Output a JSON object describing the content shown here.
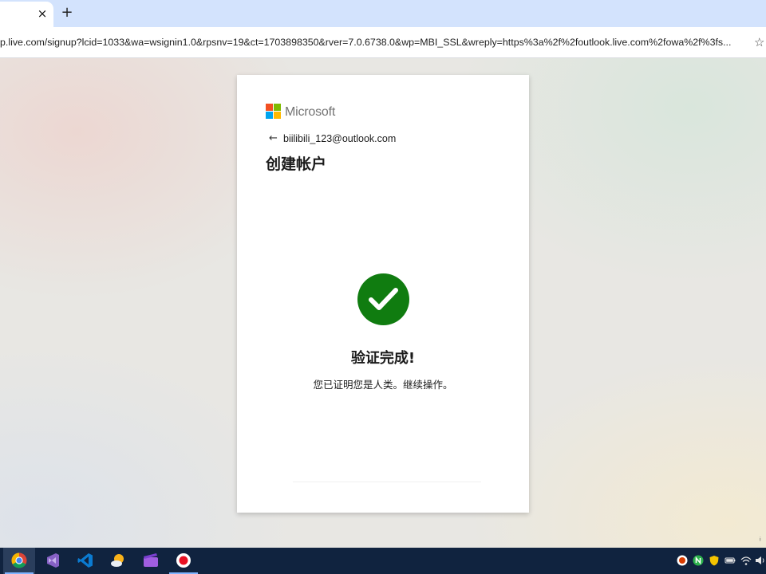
{
  "browser": {
    "close_tab_glyph": "×",
    "new_tab_glyph": "+",
    "url": "p.live.com/signup?lcid=1033&wa=wsignin1.0&rpsnv=19&ct=1703898350&rver=7.0.6738.0&wp=MBI_SSL&wreply=https%3a%2f%2foutlook.live.com%2fowa%2f%3fs...",
    "bookmark_glyph": "☆"
  },
  "card": {
    "brand_name": "Microsoft",
    "back_glyph": "←",
    "email": "biilibili_123@outlook.com",
    "title": "创建帐户",
    "status_title": "验证完成!",
    "status_message": "您已证明您是人类。继续操作。"
  },
  "page": {
    "corner_glyph": "ᵢ"
  },
  "taskbar": {
    "apps": [
      {
        "name": "chrome-icon",
        "active": true
      },
      {
        "name": "visual-studio-icon",
        "active": false
      },
      {
        "name": "vscode-icon",
        "active": false
      },
      {
        "name": "weather-icon",
        "active": false
      },
      {
        "name": "video-editor-icon",
        "active": false
      },
      {
        "name": "screen-recorder-icon",
        "active": false
      }
    ],
    "tray": [
      "record-icon",
      "network-app-icon",
      "security-shield-icon",
      "battery-icon",
      "wifi-icon",
      "volume-icon"
    ]
  },
  "colors": {
    "tab_strip": "#d3e3fd",
    "success_green": "#107c10",
    "taskbar": "#10233f",
    "ms_red": "#f25022",
    "ms_green": "#7fba00",
    "ms_blue": "#00a4ef",
    "ms_yellow": "#ffb900"
  }
}
